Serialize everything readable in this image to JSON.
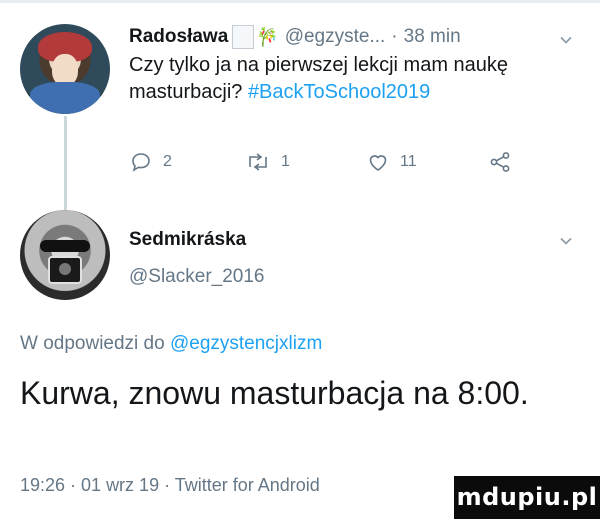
{
  "parent_tweet": {
    "display_name": "Radosława",
    "emoji_glyph": "🎋",
    "handle": "@egzyste...",
    "separator": "·",
    "time": "38 min",
    "text_before": "Czy tylko ja na pierwszej lekcji mam naukę masturbacji? ",
    "hashtag": "#BackToSchool2019",
    "replies_count": "2",
    "retweets_count": "1",
    "likes_count": "11",
    "icons": [
      "reply-icon",
      "retweet-icon",
      "heart-icon",
      "share-icon",
      "chevron-down-icon"
    ]
  },
  "reply_tweet": {
    "display_name": "Sedmikráska",
    "handle": "@Slacker_2016",
    "reply_prefix": "W odpowiedzi do ",
    "reply_mention": "@egzystencjxlizm",
    "text": "Kurwa, znowu masturbacja na 8:00.",
    "meta": "19:26 · 01 wrz 19 · ",
    "source": "Twitter for Android"
  },
  "watermark": "mdupiu.pl",
  "colors": {
    "link": "#1da1f2",
    "secondary_text": "#657786",
    "primary_text": "#14171a",
    "thread_line": "#ccd6dd"
  }
}
